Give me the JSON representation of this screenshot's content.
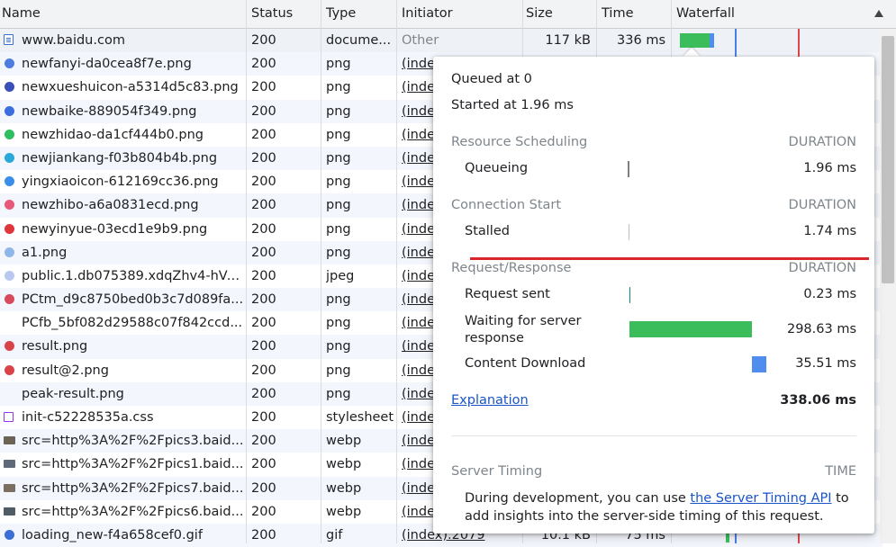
{
  "columns": {
    "name": "Name",
    "status": "Status",
    "type": "Type",
    "initiator": "Initiator",
    "size": "Size",
    "time": "Time",
    "waterfall": "Waterfall"
  },
  "rows": [
    {
      "name": "www.baidu.com",
      "status": "200",
      "type": "docume...",
      "initiator": "Other",
      "size": "117 kB",
      "time": "336 ms",
      "icon": "document-icon",
      "color": "#3b6fd6"
    },
    {
      "name": "newfanyi-da0cea8f7e.png",
      "status": "200",
      "type": "png",
      "initiator": "(index)",
      "size": "",
      "time": "",
      "icon": "image-icon",
      "color": "#4e7de0"
    },
    {
      "name": "newxueshuicon-a5314d5c83.png",
      "status": "200",
      "type": "png",
      "initiator": "(index)",
      "size": "",
      "time": "",
      "icon": "image-icon",
      "color": "#3a4fb8"
    },
    {
      "name": "newbaike-889054f349.png",
      "status": "200",
      "type": "png",
      "initiator": "(index)",
      "size": "",
      "time": "",
      "icon": "image-icon",
      "color": "#3c6de0"
    },
    {
      "name": "newzhidao-da1cf444b0.png",
      "status": "200",
      "type": "png",
      "initiator": "(index)",
      "size": "",
      "time": "",
      "icon": "image-icon",
      "color": "#2fbf60"
    },
    {
      "name": "newjiankang-f03b804b4b.png",
      "status": "200",
      "type": "png",
      "initiator": "(index)",
      "size": "",
      "time": "",
      "icon": "image-icon",
      "color": "#2aa8d8"
    },
    {
      "name": "yingxiaoicon-612169cc36.png",
      "status": "200",
      "type": "png",
      "initiator": "(index)",
      "size": "",
      "time": "",
      "icon": "image-icon",
      "color": "#3c8fe8"
    },
    {
      "name": "newzhibo-a6a0831ecd.png",
      "status": "200",
      "type": "png",
      "initiator": "(index)",
      "size": "",
      "time": "",
      "icon": "image-icon",
      "color": "#e8587a"
    },
    {
      "name": "newyinyue-03ecd1e9b9.png",
      "status": "200",
      "type": "png",
      "initiator": "(index)",
      "size": "",
      "time": "",
      "icon": "image-icon",
      "color": "#e0353b"
    },
    {
      "name": "a1.png",
      "status": "200",
      "type": "png",
      "initiator": "(index)",
      "size": "",
      "time": "",
      "icon": "image-icon",
      "color": "#8fb6e8"
    },
    {
      "name": "public.1.db075389.xdqZhv4-hVa...",
      "status": "200",
      "type": "jpeg",
      "initiator": "(index)",
      "size": "",
      "time": "",
      "icon": "image-icon",
      "color": "#b9c8ee"
    },
    {
      "name": "PCtm_d9c8750bed0b3c7d089fa...",
      "status": "200",
      "type": "png",
      "initiator": "(index)",
      "size": "",
      "time": "",
      "icon": "image-icon",
      "color": "#d84a5a"
    },
    {
      "name": "PCfb_5bf082d29588c07f842ccd...",
      "status": "200",
      "type": "png",
      "initiator": "(index)",
      "size": "",
      "time": "",
      "icon": "",
      "color": ""
    },
    {
      "name": "result.png",
      "status": "200",
      "type": "png",
      "initiator": "(index)",
      "size": "",
      "time": "",
      "icon": "image-icon",
      "color": "#d8434a"
    },
    {
      "name": "result@2.png",
      "status": "200",
      "type": "png",
      "initiator": "(index)",
      "size": "",
      "time": "",
      "icon": "image-icon",
      "color": "#d8434a"
    },
    {
      "name": "peak-result.png",
      "status": "200",
      "type": "png",
      "initiator": "(index)",
      "size": "",
      "time": "",
      "icon": "",
      "color": ""
    },
    {
      "name": "init-c52228535a.css",
      "status": "200",
      "type": "stylesheet",
      "initiator": "(index)",
      "size": "",
      "time": "",
      "icon": "stylesheet-icon",
      "color": "#9334e6"
    },
    {
      "name": "src=http%3A%2F%2Fpics3.baid...",
      "status": "200",
      "type": "webp",
      "initiator": "(index)",
      "size": "",
      "time": "",
      "icon": "image-icon",
      "color": "#6b6456"
    },
    {
      "name": "src=http%3A%2F%2Fpics1.baid...",
      "status": "200",
      "type": "webp",
      "initiator": "(index)",
      "size": "",
      "time": "",
      "icon": "image-icon",
      "color": "#5e6a7a"
    },
    {
      "name": "src=http%3A%2F%2Fpics7.baid...",
      "status": "200",
      "type": "webp",
      "initiator": "(index)",
      "size": "",
      "time": "",
      "icon": "image-icon",
      "color": "#7a6f60"
    },
    {
      "name": "src=http%3A%2F%2Fpics6.baid...",
      "status": "200",
      "type": "webp",
      "initiator": "(index)",
      "size": "",
      "time": "",
      "icon": "image-icon",
      "color": "#4f5c66"
    },
    {
      "name": "loading_new-f4a658cef0.gif",
      "status": "200",
      "type": "gif",
      "initiator": "(index).2079",
      "size": "10.1 kB",
      "time": "75 ms",
      "icon": "image-icon",
      "color": "#3b6fd6"
    }
  ],
  "popover": {
    "queued": "Queued at 0",
    "started": "Started at 1.96 ms",
    "sections": [
      {
        "title": "Resource Scheduling",
        "duration_label": "DURATION",
        "items": [
          {
            "label": "Queueing",
            "value": "1.96 ms",
            "bar_fraction": 0.006,
            "bar_color": "#7f7f7f"
          }
        ]
      },
      {
        "title": "Connection Start",
        "duration_label": "DURATION",
        "items": [
          {
            "label": "Stalled",
            "value": "1.74 ms",
            "bar_fraction": 0.005,
            "bar_color": "#c0c0c0"
          }
        ]
      },
      {
        "title": "Request/Response",
        "duration_label": "DURATION",
        "items": [
          {
            "label": "Request sent",
            "value": "0.23 ms",
            "bar_fraction": 0.001,
            "bar_color": "#0f8a8a"
          },
          {
            "label": "Waiting for server response",
            "value": "298.63 ms",
            "bar_fraction": 0.883,
            "bar_color": "#3cbd5c"
          },
          {
            "label": "Content Download",
            "value": "35.51 ms",
            "bar_fraction": 0.105,
            "bar_color": "#4f8def"
          }
        ]
      }
    ],
    "explanation": "Explanation",
    "total": "338.06 ms",
    "server_timing": {
      "title": "Server Timing",
      "time_label": "TIME",
      "text_before": "During development, you can use ",
      "link_text": "the Server Timing API",
      "text_after": " to add insights into the server-side timing of this request."
    }
  },
  "colors": {
    "waiting": "#3cbd5c",
    "download": "#4f8def",
    "dom_content_loaded": "#4a7fe8",
    "load_event": "#e0474c",
    "annotation": "#d9262d"
  }
}
